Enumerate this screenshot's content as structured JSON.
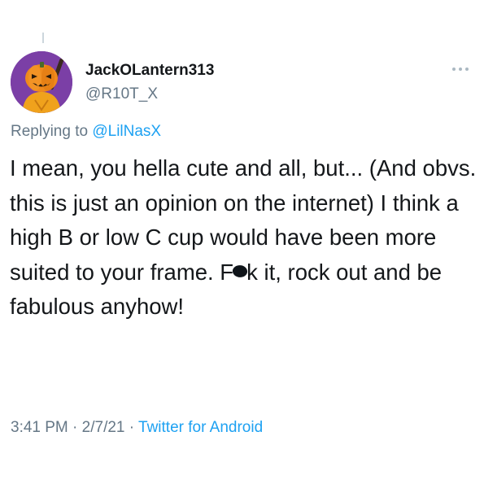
{
  "tweet": {
    "display_name": "JackOLantern313",
    "handle": "@R10T_X",
    "replying_prefix": "Replying to ",
    "replying_to": "@LilNasX",
    "text_before_redaction": "I mean, you hella cute and all, but... (And obvs. this is just an opinion on the internet) I think a high B or low C cup would have been more suited to your frame. F",
    "text_after_redaction": "k it, rock out and be fabulous anyhow!",
    "time": "3:41 PM",
    "separator_1": " · ",
    "date": "2/7/21",
    "separator_2": " · ",
    "source": "Twitter for Android"
  },
  "colors": {
    "text": "#14171a",
    "secondary": "#657786",
    "link": "#1da1f2",
    "avatar_bg": "#7b3fa6",
    "pumpkin": "#f08a1c"
  },
  "icons": {
    "more": "more-horizontal-icon",
    "avatar": "pumpkin-head-avatar"
  }
}
